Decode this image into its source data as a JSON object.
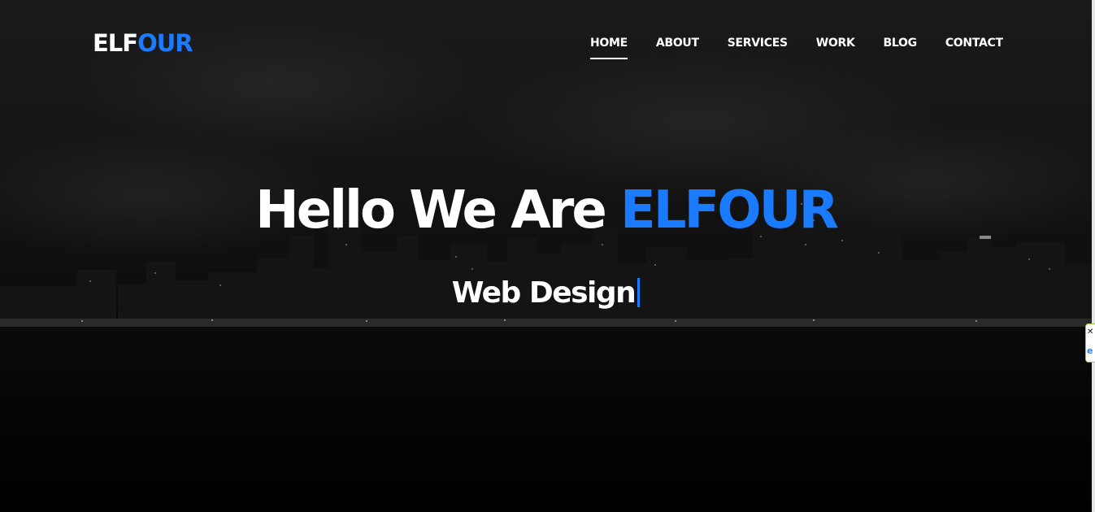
{
  "logo": {
    "part1": "ELF",
    "part2": "OUR"
  },
  "nav": {
    "items": [
      {
        "label": "HOME",
        "active": true
      },
      {
        "label": "ABOUT",
        "active": false
      },
      {
        "label": "SERVICES",
        "active": false
      },
      {
        "label": "WORK",
        "active": false
      },
      {
        "label": "BLOG",
        "active": false
      },
      {
        "label": "CONTACT",
        "active": false
      }
    ]
  },
  "hero": {
    "headline_prefix": "Hello We Are ",
    "headline_brand": "ELFOUR",
    "typed_text": "Web Design"
  },
  "colors": {
    "accent": "#1a7bff",
    "text": "#ffffff",
    "background": "#111111"
  },
  "side_widget": {
    "close_icon": "close-icon",
    "extension_icon": "e-icon"
  }
}
